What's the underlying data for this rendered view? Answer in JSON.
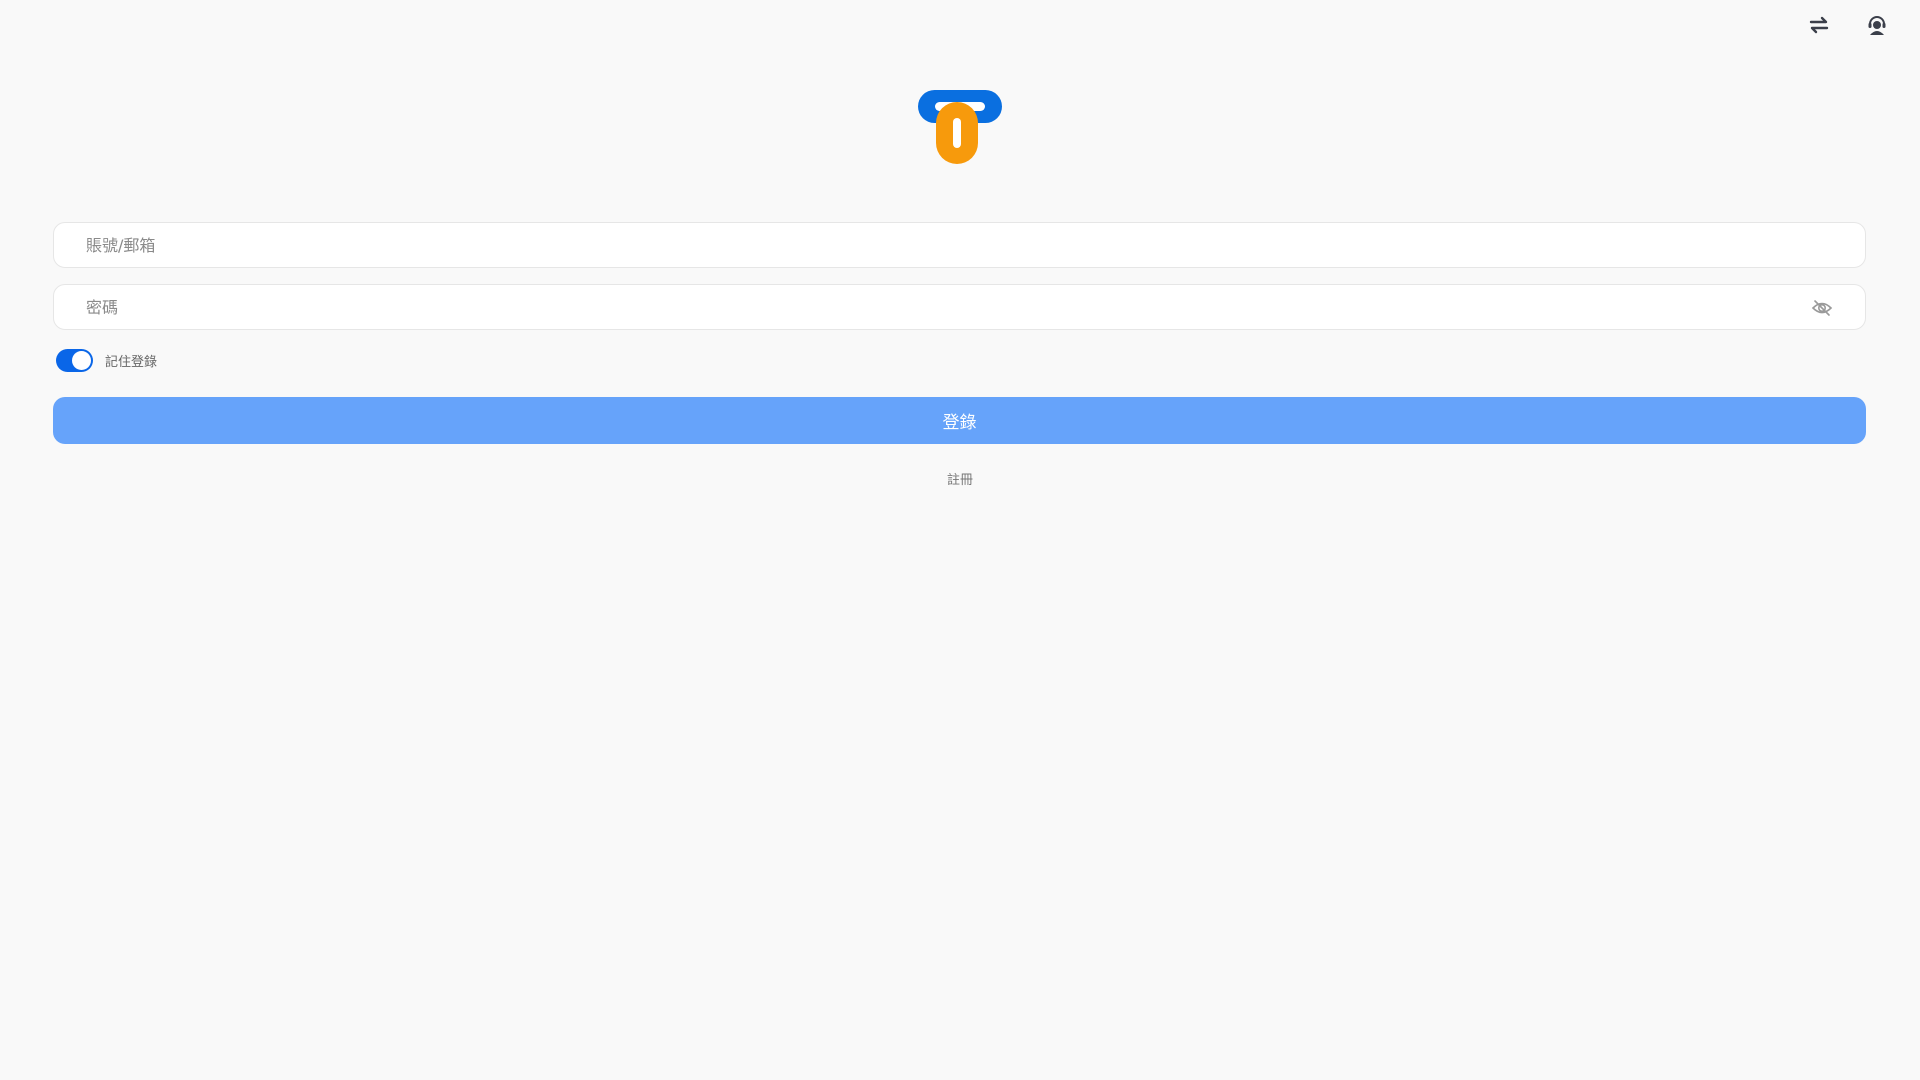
{
  "header": {
    "icons": [
      "swap-icon",
      "support-agent-icon"
    ]
  },
  "logo": {
    "colors": {
      "blue": "#0a6fe0",
      "orange": "#f79a0c"
    }
  },
  "form": {
    "account_placeholder": "賬號/郵箱",
    "password_placeholder": "密碼",
    "remember_label": "記住登錄",
    "remember_on": true,
    "login_label": "登錄",
    "register_label": "註冊"
  },
  "colors": {
    "accent": "#0a66e8",
    "button": "#66a3fa",
    "background": "#f9f9f9"
  }
}
